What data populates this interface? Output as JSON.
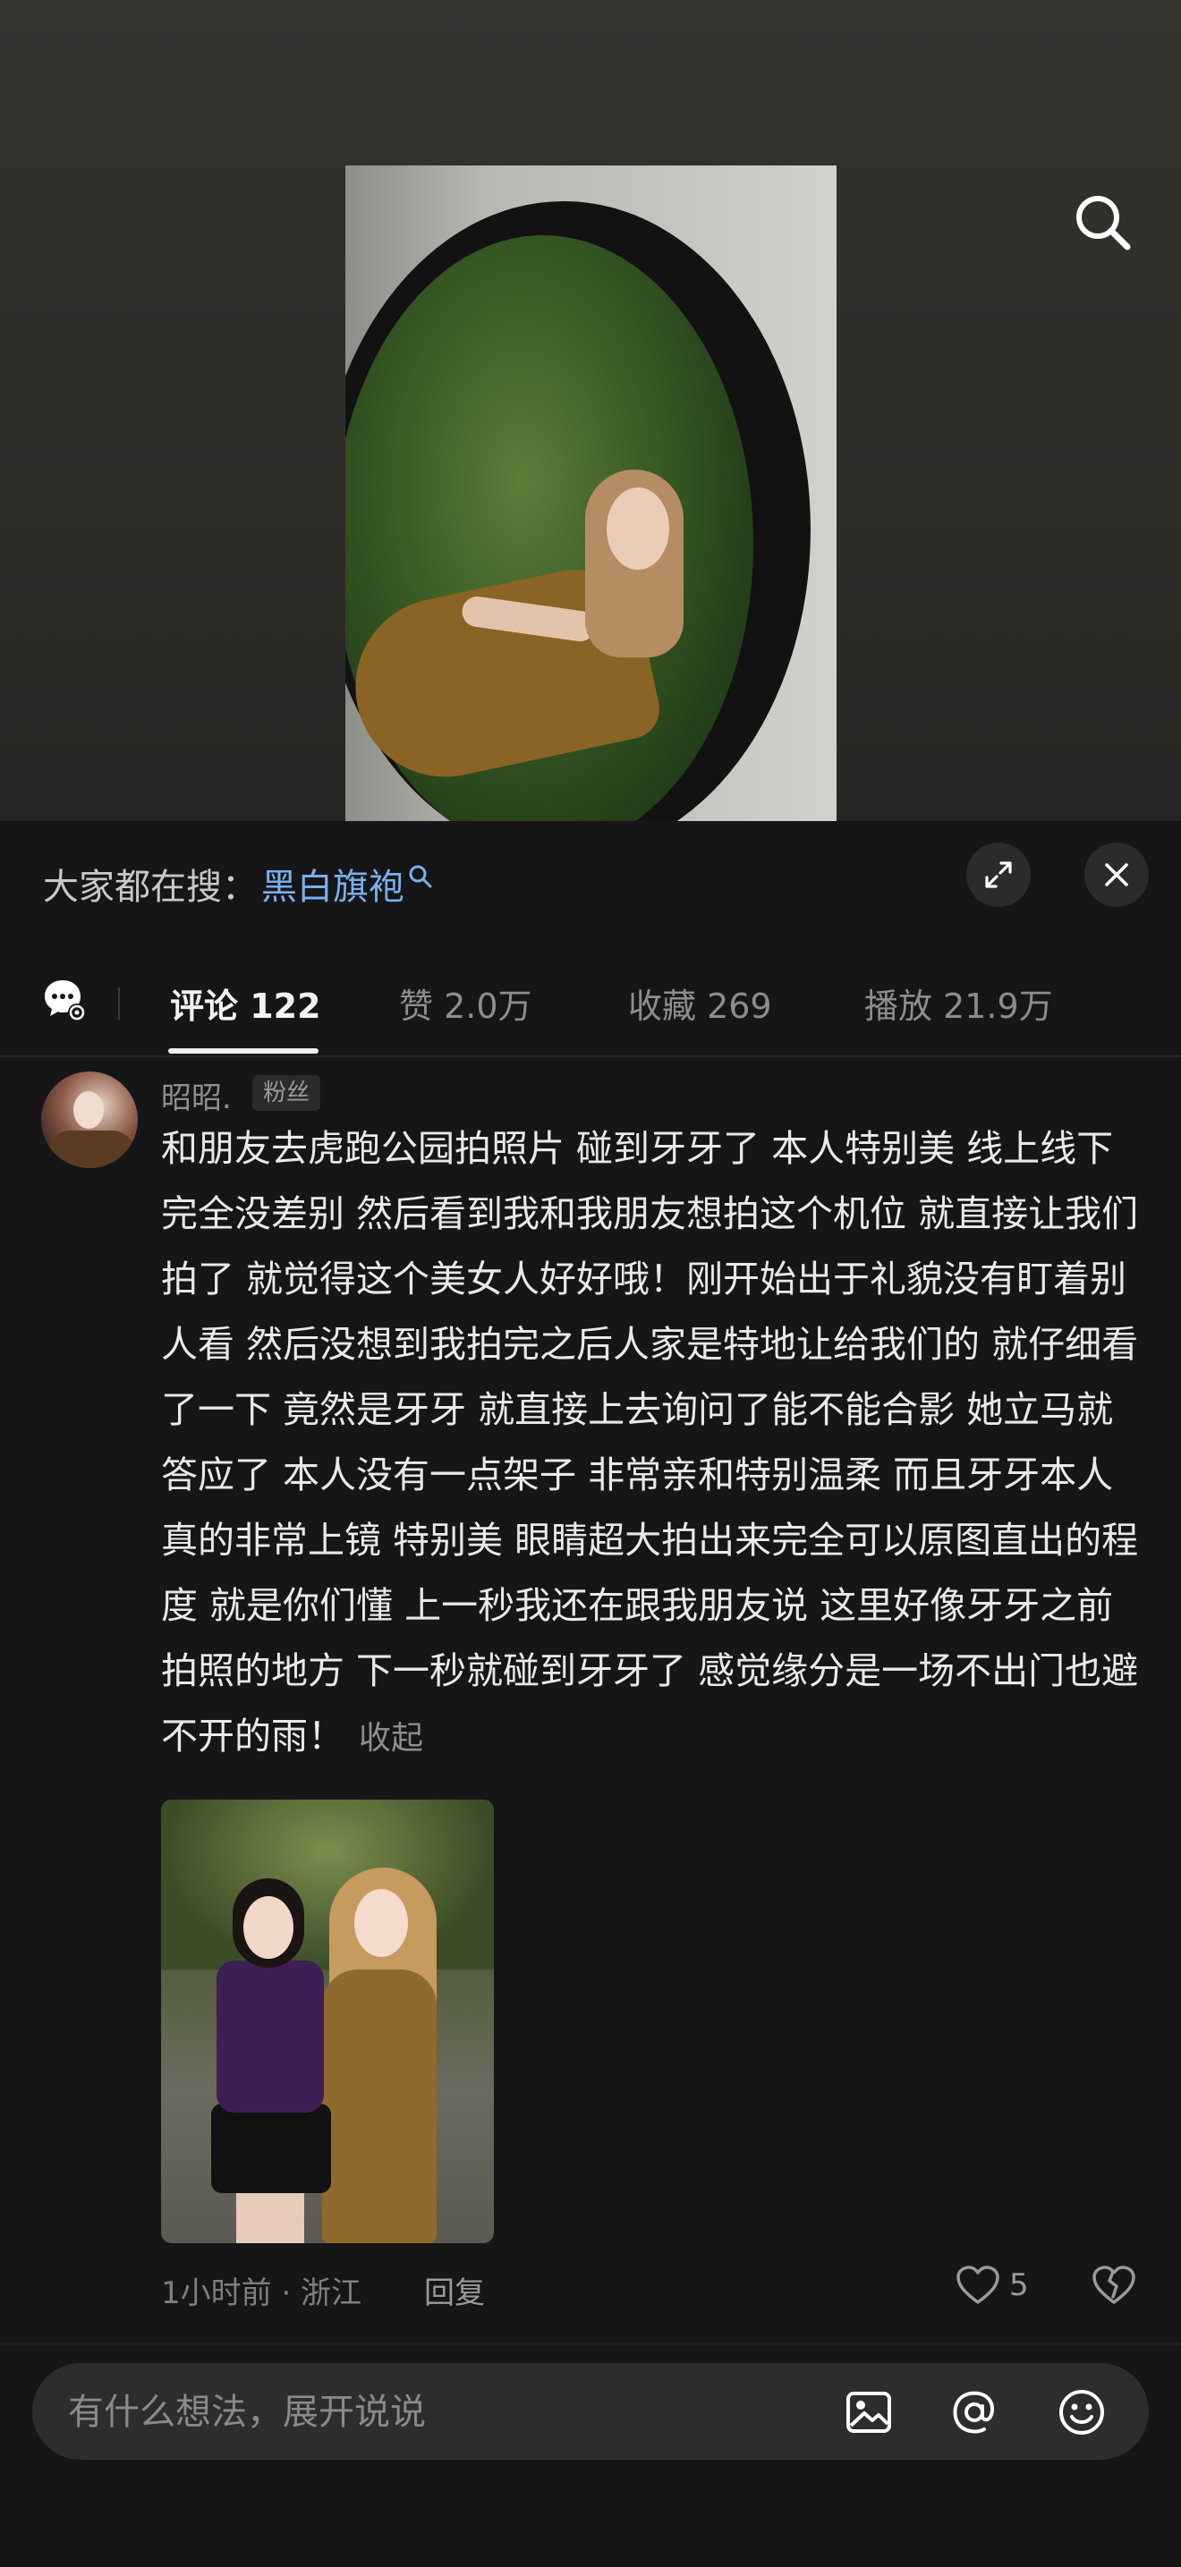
{
  "trending": {
    "label": "大家都在搜：",
    "query": "黑白旗袍"
  },
  "tabs": [
    {
      "label": "评论 122"
    },
    {
      "label": "赞 2.0万"
    },
    {
      "label": "收藏 269"
    },
    {
      "label": "播放 21.9万"
    }
  ],
  "comment": {
    "username": "昭昭.",
    "badge": "粉丝",
    "text": "和朋友去虎跑公园拍照片 碰到牙牙了 本人特别美 线上线下完全没差别  然后看到我和我朋友想拍这个机位 就直接让我们拍了 就觉得这个美女人好好哦！刚开始出于礼貌没有盯着别人看 然后没想到我拍完之后人家是特地让给我们的  就仔细看了一下 竟然是牙牙 就直接上去询问了能不能合影 她立马就答应了 本人没有一点架子 非常亲和特别温柔 而且牙牙本人真的非常上镜 特别美 眼睛超大拍出来完全可以原图直出的程度 就是你们懂 上一秒我还在跟我朋友说 这里好像牙牙之前拍照的地方 下一秒就碰到牙牙了 感觉缘分是一场不出门也避不开的雨！",
    "collapse": "收起",
    "meta": "1小时前 · 浙江",
    "reply": "回复",
    "likes": "5"
  },
  "input": {
    "placeholder": "有什么想法，展开说说"
  },
  "icons": {
    "search": "search-icon",
    "expand": "expand-icon",
    "close": "close-icon",
    "chat": "chat-settings-icon",
    "heart": "heart-icon",
    "dislike": "broken-heart-icon",
    "image": "image-icon",
    "mention": "at-icon",
    "emoji": "emoji-icon"
  },
  "colors": {
    "link": "#7ab0ee",
    "badge_red": "#e8334d",
    "background": "#161616"
  }
}
